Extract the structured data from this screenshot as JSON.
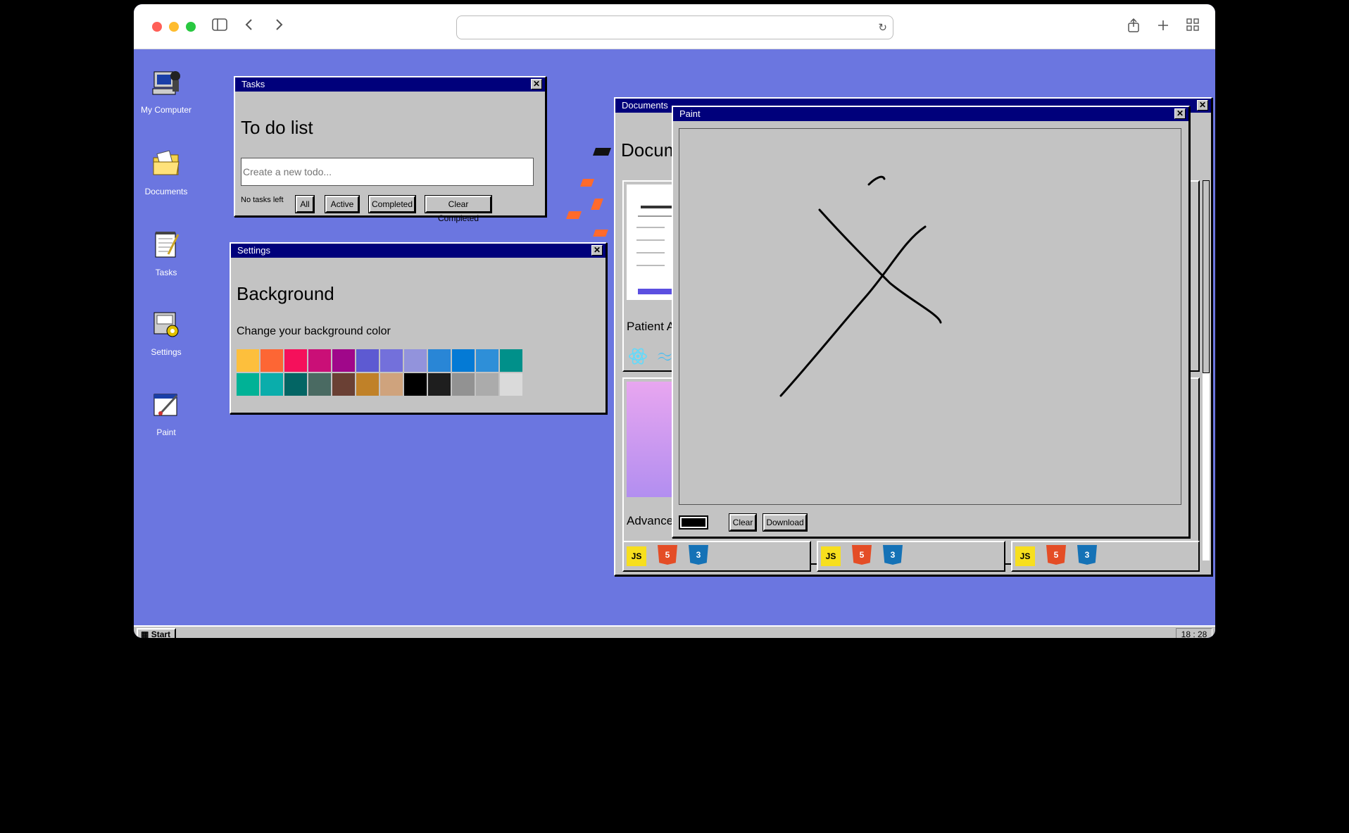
{
  "desktop_icons": [
    {
      "label": "My Computer",
      "icon": "computer-icon"
    },
    {
      "label": "Documents",
      "icon": "folder-icon"
    },
    {
      "label": "Tasks",
      "icon": "notepad-icon"
    },
    {
      "label": "Settings",
      "icon": "settings-icon"
    },
    {
      "label": "Paint",
      "icon": "paint-icon"
    }
  ],
  "tasks": {
    "window_title": "Tasks",
    "heading": "To do list",
    "placeholder": "Create a new todo...",
    "count_text": "No tasks left",
    "filters": [
      "All",
      "Active",
      "Completed",
      "Clear Completed"
    ]
  },
  "settings": {
    "window_title": "Settings",
    "heading": "Background",
    "subheading": "Change your background color",
    "colors": [
      "#fdbf3c",
      "#fd6634",
      "#f5105b",
      "#ca0f77",
      "#a0078a",
      "#5d5ad2",
      "#7370db",
      "#9293dc",
      "#2986d6",
      "#047ad5",
      "#2e8fd8",
      "#00908a",
      "#00b296",
      "#0aadab",
      "#036564",
      "#4a6a62",
      "#6a4034",
      "#c08128",
      "#cfa37d",
      "#000000",
      "#1e1e1e",
      "#929292",
      "#ababab",
      "#dadada"
    ]
  },
  "documents": {
    "window_title": "Documents",
    "heading": "Docum",
    "project_1": "Patient Ap",
    "project_2": "Advance"
  },
  "paint": {
    "window_title": "Paint",
    "current_color": "#000000",
    "clear_label": "Clear",
    "download_label": "Download"
  },
  "taskbar": {
    "start_label": "Start",
    "clock": "18 : 28"
  }
}
